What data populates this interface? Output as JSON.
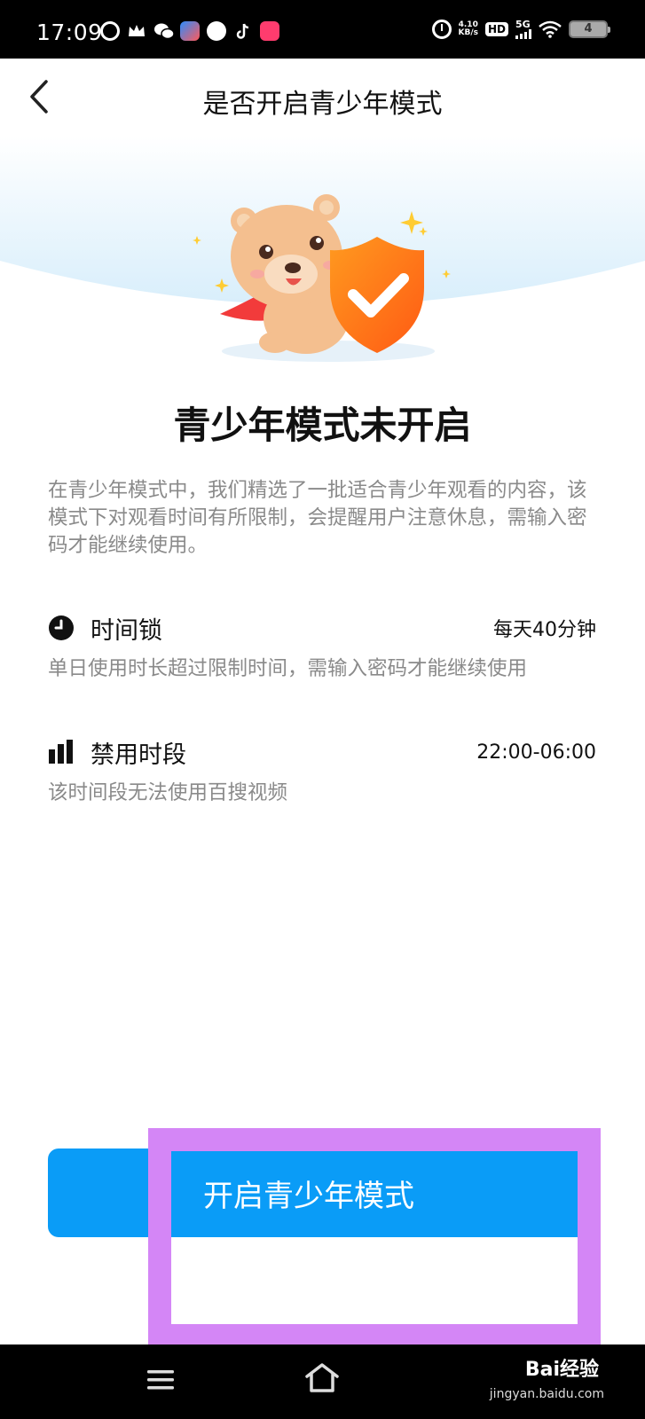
{
  "status_bar": {
    "time": "17:09",
    "net_speed_value": "4.10",
    "net_speed_unit": "KB/s",
    "hd_label": "HD",
    "network_label": "5G",
    "battery_level": "4",
    "left_icons": [
      "video-app-icon",
      "crown-icon",
      "wechat-icon",
      "app-icon",
      "compass-icon",
      "tiktok-icon",
      "photo-app-icon"
    ]
  },
  "header": {
    "title": "是否开启青少年模式"
  },
  "main": {
    "heading": "青少年模式未开启",
    "intro": "在青少年模式中，我们精选了一批适合青少年观看的内容，该模式下对观看时间有所限制，会提醒用户注意休息，需输入密码才能继续使用。"
  },
  "features": [
    {
      "icon": "clock-icon",
      "title": "时间锁",
      "value": "每天40分钟",
      "desc": "单日使用时长超过限制时间，需输入密码才能继续使用"
    },
    {
      "icon": "bar-chart-icon",
      "title": "禁用时段",
      "value": "22:00-06:00",
      "desc": "该时间段无法使用百搜视频"
    }
  ],
  "action": {
    "enable_label": "开启青少年模式"
  },
  "watermark": {
    "brand": "Bai经验",
    "url": "jingyan.baidu.com"
  },
  "colors": {
    "primary": "#0a9cf7",
    "highlight": "#d486f6",
    "shield": "#ff6a1a"
  }
}
